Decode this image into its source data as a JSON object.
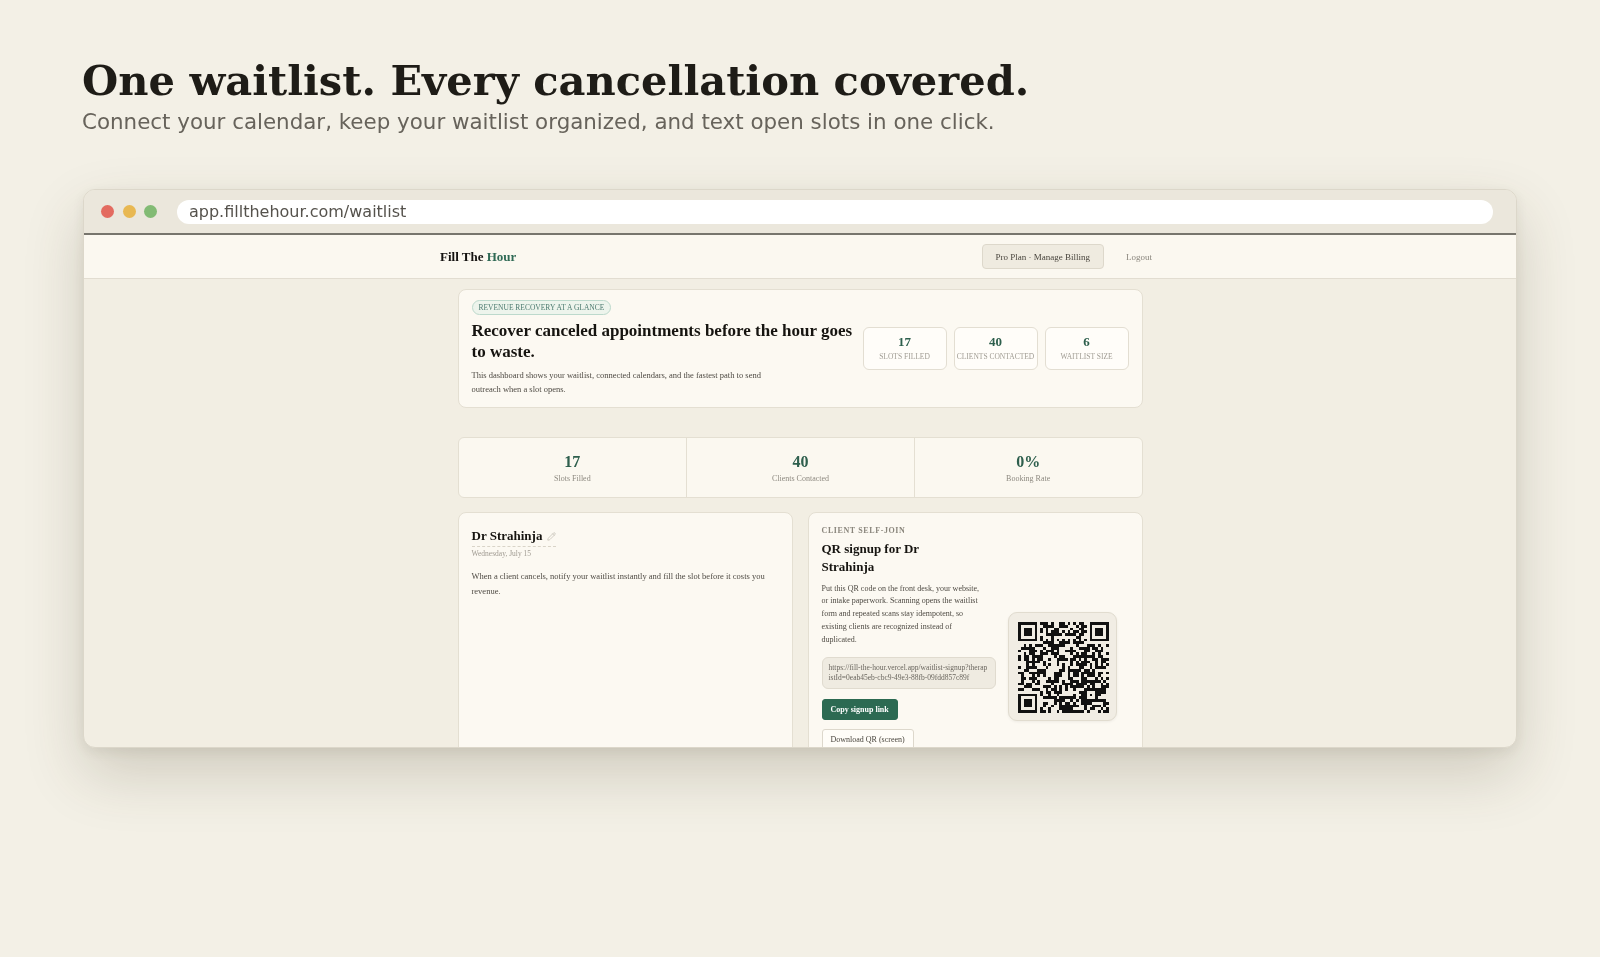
{
  "hero": {
    "title": "One waitlist. Every cancellation covered.",
    "subtitle": "Connect your calendar, keep your waitlist organized, and text open slots in one click."
  },
  "browser": {
    "window_dots": [
      {
        "color": "#e36b60"
      },
      {
        "color": "#e8b852"
      },
      {
        "color": "#82bb74"
      }
    ],
    "url": "app.fillthehour.com/waitlist"
  },
  "app": {
    "nav": {
      "logo": {
        "text": "Fill The",
        "accent": "Hour"
      },
      "billing_button": "Pro Plan · Manage Billing",
      "logout_link": "Logout"
    },
    "overview": {
      "badge": "REVENUE RECOVERY AT A GLANCE",
      "title": "Recover canceled appointments before the hour goes to waste.",
      "description": "This dashboard shows your waitlist, connected calendars, and the fastest path to send outreach when a slot opens.",
      "stats": [
        {
          "value": "17",
          "label": "SLOTS FILLED"
        },
        {
          "value": "40",
          "label": "CLIENTS CONTACTED"
        },
        {
          "value": "6",
          "label": "WAITLIST SIZE"
        }
      ]
    },
    "metrics": [
      {
        "value": "17",
        "label": "Slots Filled"
      },
      {
        "value": "40",
        "label": "Clients Contacted"
      },
      {
        "value": "0%",
        "label": "Booking Rate"
      }
    ],
    "practice_card": {
      "name": "Dr Strahinja",
      "date": "Wednesday, July 15",
      "description": "When a client cancels, notify your waitlist instantly and fill the slot before it costs you revenue."
    },
    "signup_card": {
      "eyebrow": "CLIENT SELF-JOIN",
      "title": "QR signup for Dr Strahinja",
      "description": "Put this QR code on the front desk, your website, or intake paperwork. Scanning opens the waitlist form and repeated scans stay idempotent, so existing clients are recognized instead of duplicated.",
      "signup_link": "https://fill-the-hour.vercel.app/waitlist-signup?therapistId=0eab45eb-cbc9-49e3-88fb-09fdd857c89f",
      "buttons": [
        {
          "label": "Copy signup link",
          "kind": "primary"
        },
        {
          "label": "Download QR (screen)",
          "kind": "secondary"
        }
      ]
    }
  }
}
